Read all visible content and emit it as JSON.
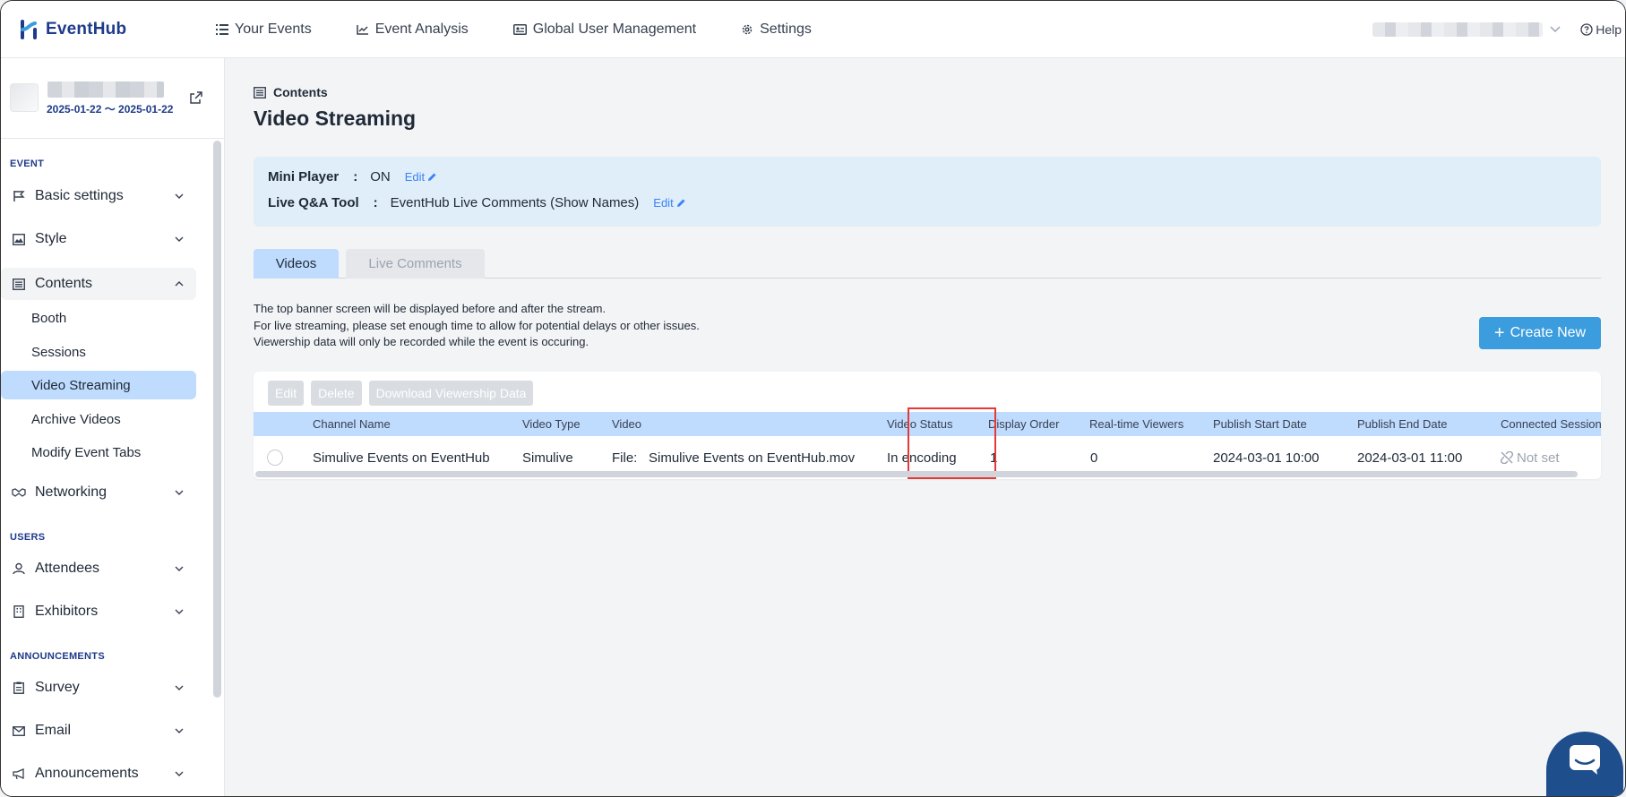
{
  "app": {
    "name": "EventHub"
  },
  "nav": {
    "items": [
      {
        "label": "Your Events",
        "icon": "list-icon"
      },
      {
        "label": "Event Analysis",
        "icon": "chart-icon"
      },
      {
        "label": "Global User Management",
        "icon": "id-card-icon"
      },
      {
        "label": "Settings",
        "icon": "gear-icon"
      }
    ],
    "help_label": "Help"
  },
  "event": {
    "dates": "2025-01-22 〜 2025-01-22"
  },
  "sidebar": {
    "sections": {
      "event": "EVENT",
      "users": "USERS",
      "announcements": "ANNOUNCEMENTS"
    },
    "items": {
      "basic_settings": "Basic settings",
      "style": "Style",
      "contents": "Contents",
      "booth": "Booth",
      "sessions": "Sessions",
      "video_streaming": "Video Streaming",
      "archive_videos": "Archive Videos",
      "modify_event_tabs": "Modify Event Tabs",
      "networking": "Networking",
      "attendees": "Attendees",
      "exhibitors": "Exhibitors",
      "survey": "Survey",
      "email": "Email",
      "announcements": "Announcements"
    }
  },
  "main": {
    "breadcrumb": "Contents",
    "title": "Video Streaming",
    "info": {
      "mini_player_label": "Mini Player",
      "mini_player_value": "ON",
      "qa_label": "Live Q&A Tool",
      "qa_value": "EventHub Live Comments (Show Names)",
      "colon": ":",
      "edit_label": "Edit"
    },
    "tabs": [
      "Videos",
      "Live Comments"
    ],
    "notes": [
      "The top banner screen will be displayed before and after the stream.",
      "For live streaming, please set enough time to allow for potential delays or other issues.",
      "Viewership data will only be recorded while the event is occuring."
    ],
    "create_label": "Create New",
    "toolbar": {
      "edit": "Edit",
      "delete": "Delete",
      "download": "Download Viewership Data"
    },
    "table": {
      "headers": [
        "Channel Name",
        "Video Type",
        "Video",
        "Video Status",
        "Display Order",
        "Real-time Viewers",
        "Publish Start Date",
        "Publish End Date",
        "Connected Sessions"
      ],
      "rows": [
        {
          "channel_name": "Simulive Events on EventHub",
          "video_type": "Simulive",
          "video_prefix": "File:",
          "video_file": "Simulive Events on EventHub.mov",
          "video_status": "In encoding",
          "display_order": "1",
          "realtime_viewers": "0",
          "publish_start": "2024-03-01 10:00",
          "publish_end": "2024-03-01 11:00",
          "connected_sessions": "Not set"
        }
      ]
    }
  },
  "colors": {
    "accent": "#3b9ddd",
    "brand": "#1e3a8a",
    "highlight": "#e53935",
    "selected": "#bfdbfe"
  }
}
